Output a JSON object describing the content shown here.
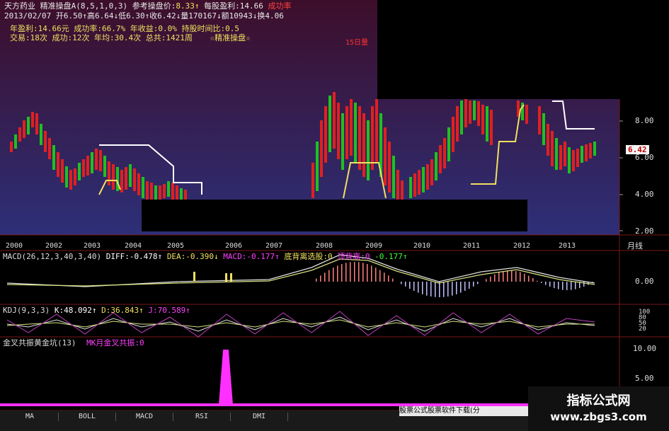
{
  "header": {
    "line1": {
      "stock_name": "天方药业",
      "indicator": "精准操盘A(8,5,1,0,3)",
      "ref_label": "参考操盘价:",
      "ref_value": "8.33↑",
      "profit_label": "每股盈利:14.66",
      "success_label": "成功率"
    },
    "line2": "2013/02/07 开6.50↑高6.64↓低6.30↑收6.42↓量170167↓额10943↓换4.06",
    "line3": "年盈利:14.66元 成功率:66.7% 年收益:0.0% 持股时间比:0.5",
    "line4a": "交易:18次 成功:12次 年均:30.4次 总共:1421周",
    "line4b": "☆精准操盘☆",
    "line5": "15日量"
  },
  "price_axis": {
    "ticks": [
      "8.00",
      "6.00",
      "4.00",
      "2.00"
    ],
    "current_price": "6.42",
    "period_label": "月线"
  },
  "year_axis": [
    "2000",
    "2002",
    "2003",
    "2004",
    "2005",
    "2006",
    "2007",
    "2008",
    "2009",
    "2010",
    "2011",
    "2012",
    "2013"
  ],
  "macd": {
    "title": "MACD(26,12,3,40,3,40)",
    "diff": "DIFF:-0.478↑",
    "dea": "DEA:-0.390↓",
    "macd": "MACD:-0.177↑",
    "bottom_label": "底背离选股:0",
    "top_label": "顶背离:0",
    "top_value": "-0.177↑",
    "axis_tick": "0.00"
  },
  "kdj": {
    "title": "KDJ(9,3,3)",
    "k": "K:48.092↑",
    "d": "D:36.843↑",
    "j": "J:70.589↑",
    "axis_ticks": [
      "100",
      "80",
      "50",
      "20"
    ]
  },
  "golden": {
    "title": "金叉共振黄金坑(13)",
    "series": "MK月金叉共振:0",
    "axis_ticks": [
      "10.00",
      "5.00"
    ]
  },
  "tabs": [
    "MA",
    "BOLL",
    "MACD",
    "RSI",
    "DMI"
  ],
  "footer_link": "股票公式股票软件下载(分",
  "watermark": {
    "title": "指标公式网",
    "url": "www.zbgs3.com"
  },
  "colors": {
    "up": "#e02020",
    "down": "#20c020",
    "panel_bg_top": "#3a1030",
    "panel_bg_bottom": "#2a2a70",
    "grid": "#8a1010",
    "magenta": "#ff30ff"
  }
}
